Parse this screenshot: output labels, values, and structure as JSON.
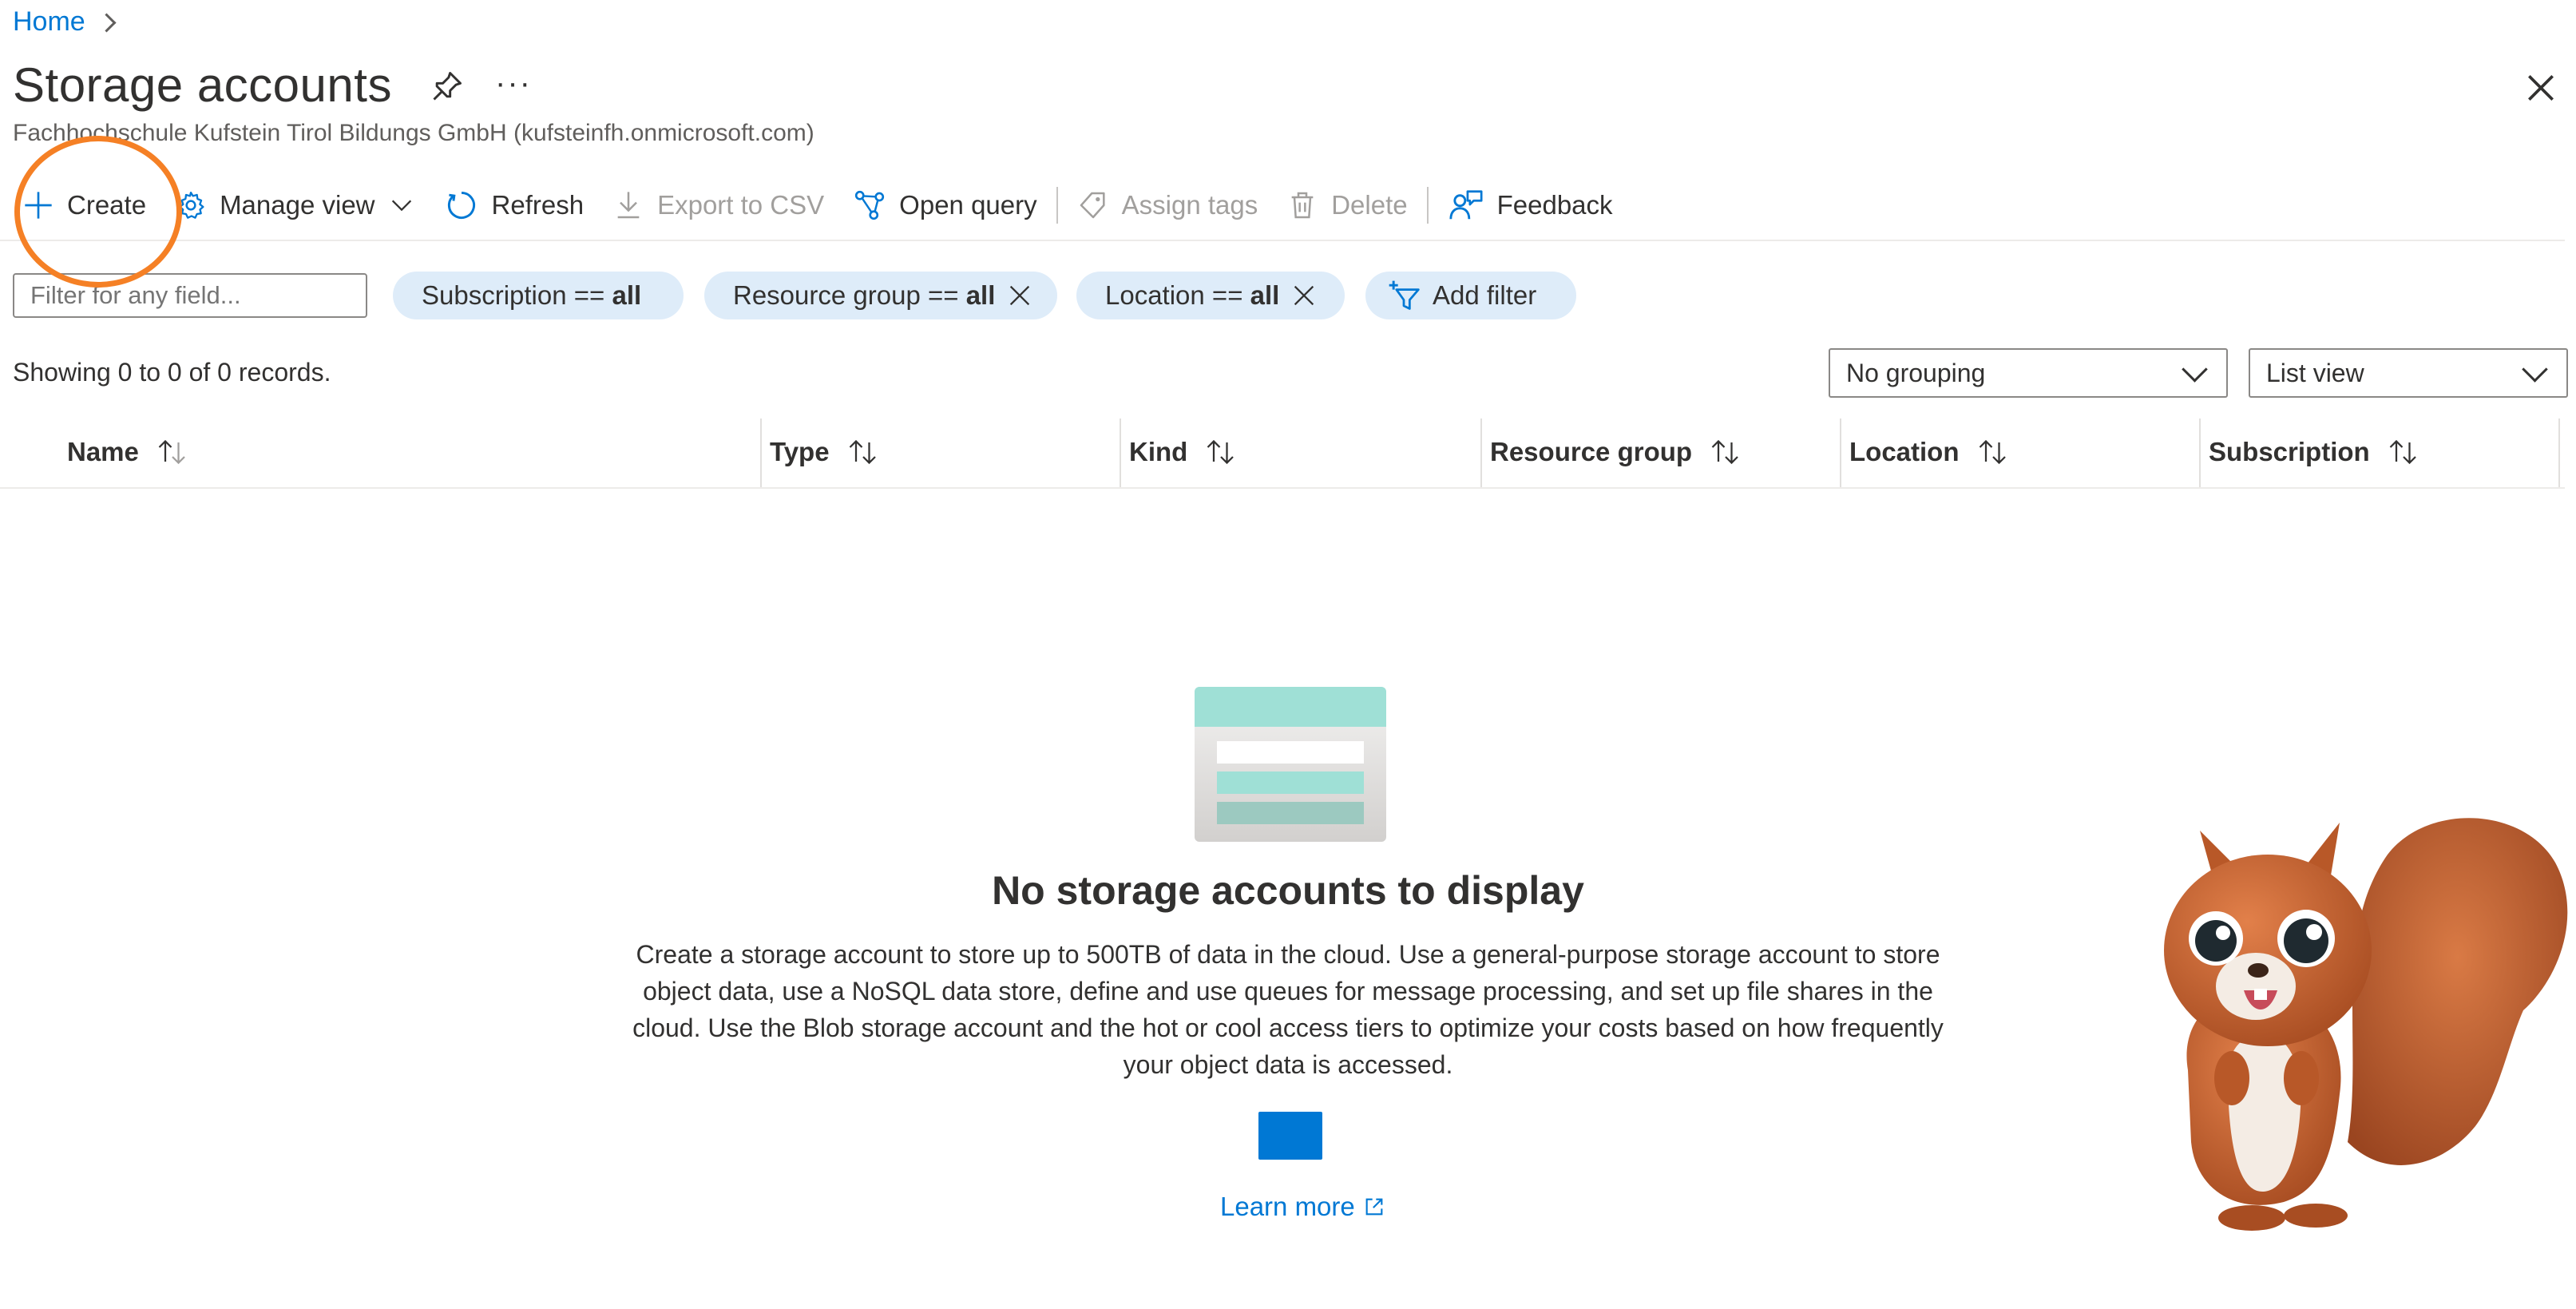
{
  "breadcrumb": {
    "home": "Home"
  },
  "header": {
    "title": "Storage accounts",
    "more": "···",
    "subtitle": "Fachhochschule Kufstein Tirol Bildungs GmbH (kufsteinfh.onmicrosoft.com)"
  },
  "toolbar": {
    "create": "Create",
    "manage_view": "Manage view",
    "refresh": "Refresh",
    "export_csv": "Export to CSV",
    "open_query": "Open query",
    "assign_tags": "Assign tags",
    "delete": "Delete",
    "feedback": "Feedback"
  },
  "filters": {
    "placeholder": "Filter for any field...",
    "subscription": {
      "label": "Subscription == ",
      "value": "all"
    },
    "resource_group": {
      "label": "Resource group == ",
      "value": "all"
    },
    "location": {
      "label": "Location == ",
      "value": "all"
    },
    "add_filter": "Add filter"
  },
  "records": "Showing 0 to 0 of 0 records.",
  "grouping": {
    "selected": "No grouping"
  },
  "view": {
    "selected": "List view"
  },
  "table": {
    "columns": [
      "Name",
      "Type",
      "Kind",
      "Resource group",
      "Location",
      "Subscription"
    ]
  },
  "empty_state": {
    "title": "No storage accounts to display",
    "description": "Create a storage account to store up to 500TB of data in the cloud. Use a general-purpose storage account to store object data, use a NoSQL data store, define and use queues for message processing, and set up file shares in the cloud. Use the Blob storage account and the hot or cool access tiers to optimize your costs based on how frequently your object data is accessed.",
    "learn_more": "Learn more"
  },
  "colors": {
    "accent": "#0078d4",
    "pill_bg": "#deecf9",
    "highlight": "#f58025",
    "squirrel": "#c4622d"
  },
  "icons": [
    "chevron-right-icon",
    "pin-icon",
    "close-icon",
    "plus-icon",
    "gear-icon",
    "chevron-down-icon",
    "refresh-icon",
    "download-icon",
    "query-icon",
    "tag-icon",
    "trash-icon",
    "feedback-icon",
    "dismiss-icon",
    "add-filter-icon",
    "sort-icon",
    "storage-illustration",
    "external-link-icon",
    "squirrel-mascot"
  ]
}
